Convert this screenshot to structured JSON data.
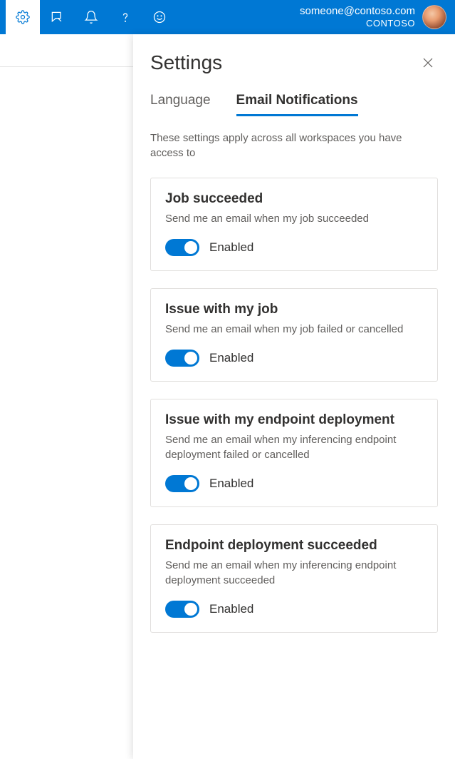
{
  "header": {
    "user_email": "someone@contoso.com",
    "user_org": "CONTOSO"
  },
  "panel": {
    "title": "Settings",
    "tabs": {
      "language": "Language",
      "email_notifications": "Email Notifications"
    },
    "info": "These settings apply across all workspaces you have access to",
    "cards": [
      {
        "title": "Job succeeded",
        "desc": "Send me an email when my job succeeded",
        "toggle_label": "Enabled",
        "enabled": true
      },
      {
        "title": "Issue with my job",
        "desc": "Send me an email when my job failed or cancelled",
        "toggle_label": "Enabled",
        "enabled": true
      },
      {
        "title": "Issue with my endpoint deployment",
        "desc": "Send me an email when my inferencing endpoint deployment failed or cancelled",
        "toggle_label": "Enabled",
        "enabled": true
      },
      {
        "title": "Endpoint deployment succeeded",
        "desc": "Send me an email when my inferencing endpoint deployment succeeded",
        "toggle_label": "Enabled",
        "enabled": true
      }
    ]
  }
}
